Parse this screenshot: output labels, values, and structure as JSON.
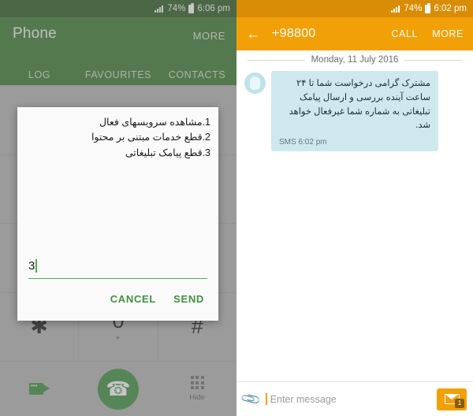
{
  "left": {
    "statusbar": {
      "signal_icon": "signal-bars-icon",
      "battery_percent": "74%",
      "battery_icon": "battery-icon",
      "time": "6:06 pm"
    },
    "appbar": {
      "title": "Phone",
      "more_label": "MORE"
    },
    "tabs": [
      {
        "label": "LOG"
      },
      {
        "label": "FAVOURITES"
      },
      {
        "label": "CONTACTS"
      }
    ],
    "dialpad": {
      "keys": [
        {
          "num": "✱",
          "sub": ""
        },
        {
          "num": "0",
          "sub": "+"
        },
        {
          "num": "#",
          "sub": ""
        }
      ],
      "video_icon": "video-call-icon",
      "call_icon": "phone-call-icon",
      "keypad_icon": "keypad-icon",
      "hide_label": "Hide"
    },
    "dialog": {
      "lines": [
        "1.مشاهده سرویسهای فعال",
        "2.قطع خدمات مبتنی بر محتوا",
        "3.قطع پیامک تبلیغاتی"
      ],
      "input_value": "3",
      "cancel_label": "CANCEL",
      "send_label": "SEND"
    }
  },
  "right": {
    "statusbar": {
      "signal_icon": "signal-bars-icon",
      "battery_percent": "74%",
      "battery_icon": "battery-icon",
      "time": "6:02 pm"
    },
    "appbar": {
      "back_icon": "back-arrow-icon",
      "title": "+98800",
      "call_label": "CALL",
      "more_label": "MORE"
    },
    "date_separator": "Monday, 11 July 2016",
    "message": {
      "avatar_icon": "contact-avatar-icon",
      "text": "مشترک گرامی درخواست شما تا ۲۴ ساعت آینده بررسی و ارسال پیامک تبلیغاتی به شماره شما غیرفعال خواهد شد.",
      "meta": "SMS 6:02 pm"
    },
    "composer": {
      "attach_icon": "paperclip-icon",
      "placeholder": "Enter message",
      "send_icon": "send-message-icon",
      "send_badge": "1"
    }
  },
  "colors": {
    "phone_green": "#3d7a33",
    "status_green": "#2d5c22",
    "message_orange": "#f2a007",
    "status_orange": "#d98c05",
    "accent_green": "#3f9142",
    "bubble_blue": "#cfe8ed"
  }
}
